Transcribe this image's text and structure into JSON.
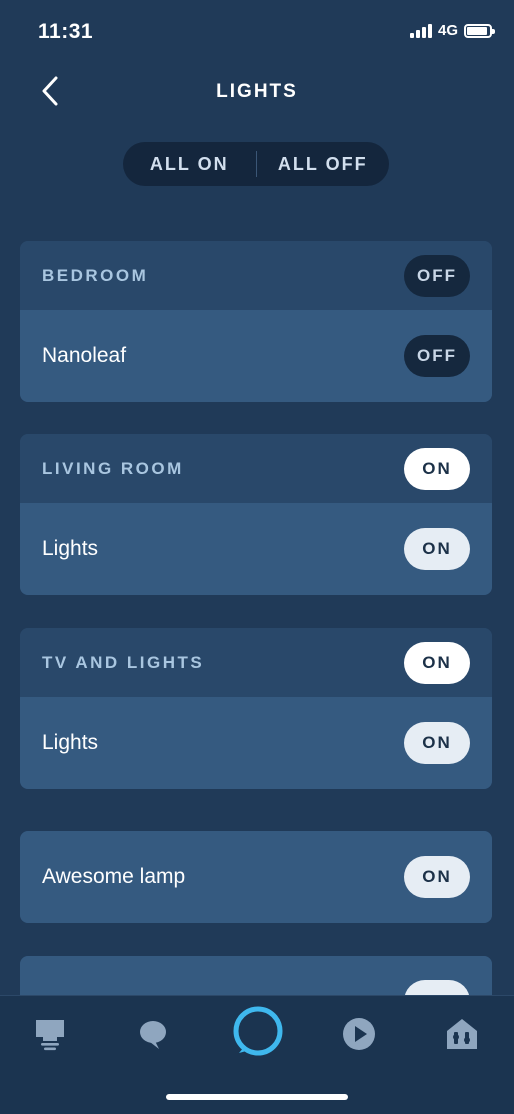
{
  "status": {
    "time": "11:31",
    "network": "4G"
  },
  "header": {
    "title": "LIGHTS",
    "back_icon": "chevron-left-icon"
  },
  "controls": {
    "all_on": "ALL ON",
    "all_off": "ALL OFF"
  },
  "groups": [
    {
      "name": "BEDROOM",
      "state": "OFF",
      "devices": [
        {
          "name": "Nanoleaf",
          "state": "OFF"
        }
      ]
    },
    {
      "name": "LIVING ROOM",
      "state": "ON",
      "devices": [
        {
          "name": "Lights",
          "state": "ON"
        }
      ]
    },
    {
      "name": "TV AND LIGHTS",
      "state": "ON",
      "devices": [
        {
          "name": "Lights",
          "state": "ON"
        }
      ]
    }
  ],
  "standalone": [
    {
      "name": "Awesome lamp",
      "state": "ON"
    }
  ],
  "tabs": [
    {
      "icon": "devices-icon"
    },
    {
      "icon": "communicate-icon"
    },
    {
      "icon": "alexa-icon"
    },
    {
      "icon": "play-icon"
    },
    {
      "icon": "smart-home-icon"
    }
  ],
  "colors": {
    "background": "#203a58",
    "alexa_ring": "#3fb8ee",
    "pill_on": "#ffffff",
    "pill_off": "#15283e"
  }
}
